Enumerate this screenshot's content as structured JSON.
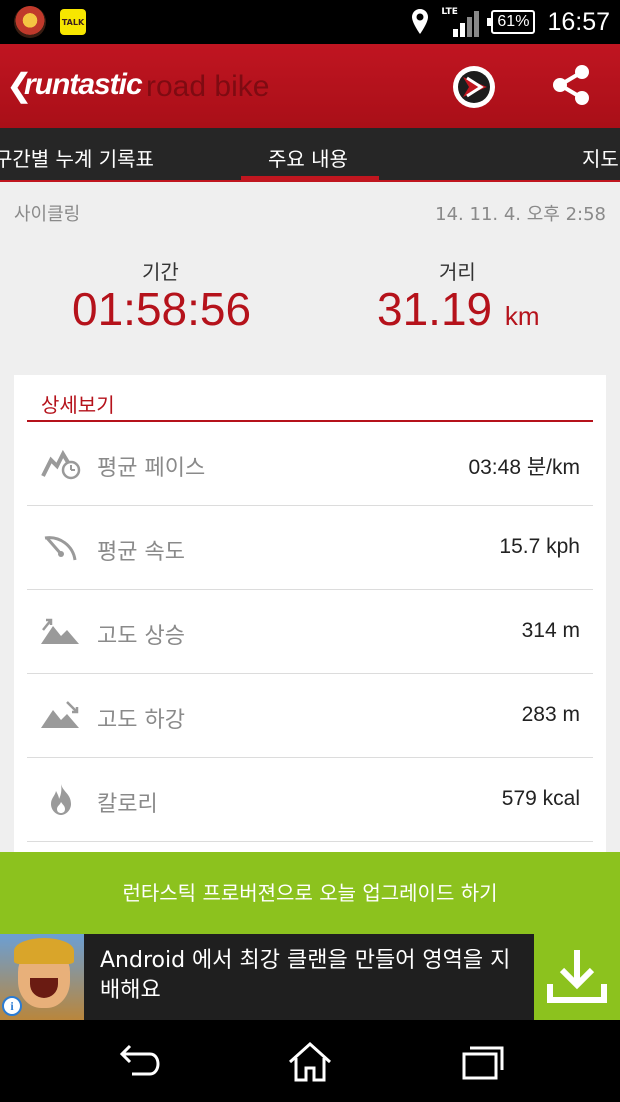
{
  "status_bar": {
    "network": "LTE",
    "battery": "61%",
    "time": "16:57",
    "icons": [
      "headphone-app-icon",
      "kakaotalk-icon",
      "location-icon",
      "lte-signal-icon",
      "battery-icon"
    ],
    "talk_label": "TALK"
  },
  "app_bar": {
    "back_glyph": "❮",
    "brand_primary": "runtastic",
    "brand_secondary": "road bike",
    "actions": [
      "story-running-icon",
      "share-icon"
    ],
    "color": "#b5121b"
  },
  "tabs": [
    {
      "label": "구간별 누계 기록표",
      "active": false
    },
    {
      "label": "주요 내용",
      "active": true
    },
    {
      "label": "지도",
      "active": false
    }
  ],
  "summary": {
    "activity": "사이클링",
    "date": "14. 11. 4. 오후 2:58",
    "duration_label": "기간",
    "duration_value": "01:58:56",
    "distance_label": "거리",
    "distance_value": "31.19",
    "distance_unit": "km"
  },
  "details": {
    "title": "상세보기",
    "rows": [
      {
        "icon": "pace-icon",
        "label": "평균 페이스",
        "value": "03:48 분/km"
      },
      {
        "icon": "speedometer-icon",
        "label": "평균 속도",
        "value": "15.7  kph"
      },
      {
        "icon": "elevation-gain-icon",
        "label": "고도 상승",
        "value": "314 m"
      },
      {
        "icon": "elevation-loss-icon",
        "label": "고도 하강",
        "value": "283 m"
      },
      {
        "icon": "flame-icon",
        "label": "칼로리",
        "value": "579 kcal"
      }
    ]
  },
  "upgrade_banner": {
    "text": "런타스틱 프로버젼으로 오늘 업그레이드 하기",
    "color": "#8cc21e"
  },
  "ad": {
    "text": "Android 에서 최강 클랜을 만들어 영역을 지배해요",
    "info_glyph": "i",
    "icons": [
      "ad-game-image",
      "ad-info-icon",
      "download-icon"
    ]
  },
  "nav_bar": {
    "buttons": [
      "back-icon",
      "home-icon",
      "recent-apps-icon"
    ]
  }
}
